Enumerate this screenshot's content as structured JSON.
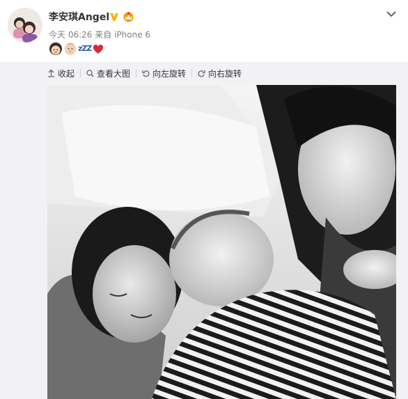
{
  "post": {
    "username": "李安琪Angel",
    "time": "今天 06:26",
    "source_prefix": "来自",
    "source": "iPhone 6",
    "emojis": [
      "girl-face-icon",
      "baby-face-icon",
      "zzz-icon",
      "red-heart-icon"
    ],
    "zzz": "zZZ"
  },
  "toolbar": {
    "collapse_label": "收起",
    "view_large_label": "查看大图",
    "rotate_left_label": "向左旋转",
    "rotate_right_label": "向右旋转"
  },
  "colors": {
    "text": "#333333",
    "meta": "#808080",
    "verified": "#f7b500",
    "media_bg": "#f2f2f5",
    "heart": "#e0243b"
  }
}
